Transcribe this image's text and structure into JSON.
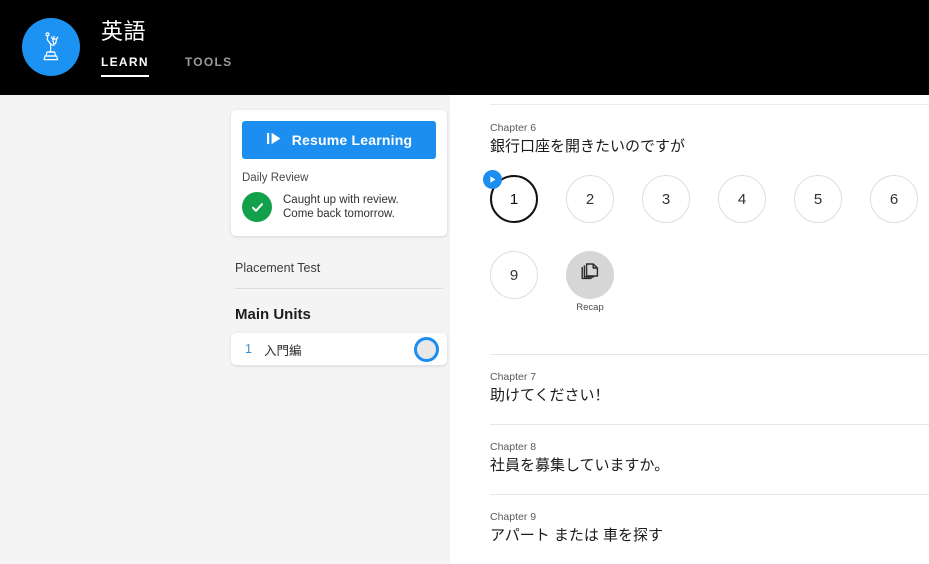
{
  "header": {
    "logo_icon": "statue-of-liberty-icon",
    "logo_bg": "#1c92f2",
    "title": "英語",
    "nav": [
      {
        "label": "LEARN",
        "active": true
      },
      {
        "label": "TOOLS",
        "active": false
      }
    ]
  },
  "sidebar": {
    "resume": {
      "label": "Resume Learning",
      "icon": "play-icon",
      "color": "#1c8ef0"
    },
    "daily_review": {
      "heading": "Daily Review",
      "status_icon": "check-circle-icon",
      "status_color": "#13a04a",
      "line1": "Caught up with review.",
      "line2": "Come back tomorrow."
    },
    "placement_test_label": "Placement Test",
    "main_units_heading": "Main Units",
    "units": [
      {
        "number": "1",
        "name": "入門編",
        "progress_color": "#1c8ef0"
      }
    ]
  },
  "content": {
    "chapters": [
      {
        "label": "Chapter 6",
        "title": "銀行口座を開きたいのですが",
        "expanded": true,
        "lessons": [
          {
            "label": "1",
            "current": true,
            "badge": "play-icon"
          },
          {
            "label": "2",
            "current": false
          },
          {
            "label": "3",
            "current": false
          },
          {
            "label": "4",
            "current": false
          },
          {
            "label": "5",
            "current": false
          },
          {
            "label": "6",
            "current": false
          },
          {
            "label": "9",
            "current": false
          }
        ],
        "recap": {
          "label": "Recap",
          "icon": "copy-pages-icon"
        }
      },
      {
        "label": "Chapter 7",
        "title": "助けてください！",
        "expanded": false
      },
      {
        "label": "Chapter 8",
        "title": "社員を募集していますか。",
        "expanded": false
      },
      {
        "label": "Chapter 9",
        "title": "アパート または 車を探す",
        "expanded": false
      }
    ]
  }
}
